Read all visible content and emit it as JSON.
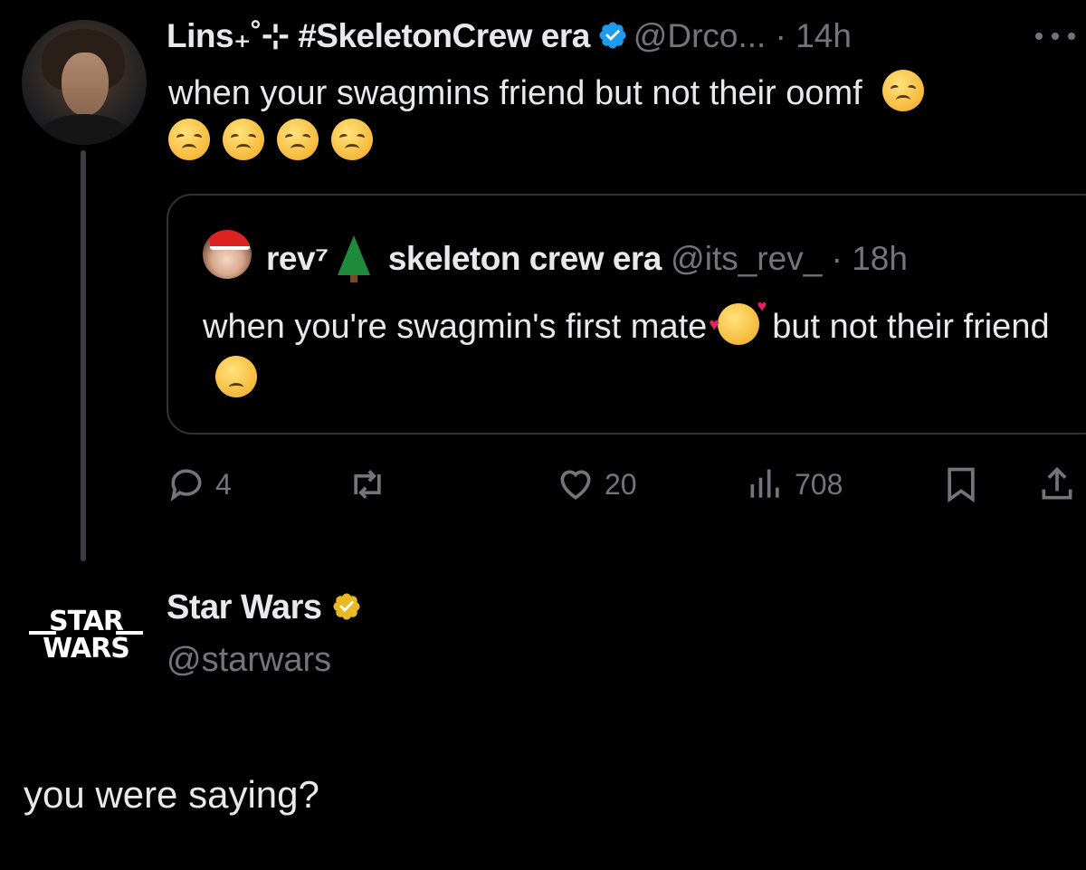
{
  "tweet": {
    "author": {
      "display_name": "Lins₊˚⊹ #SkeletonCrew era",
      "handle": "@Drco...",
      "time": "14h",
      "verified": true
    },
    "text": "when your swagmins friend but not their oomf",
    "emojis": [
      "disappointed-face",
      "disappointed-face",
      "disappointed-face",
      "disappointed-face",
      "disappointed-face"
    ],
    "quote": {
      "author": {
        "display_name": "rev⁷",
        "name_suffix": "skeleton crew era",
        "handle": "@its_rev_",
        "time": "18h"
      },
      "text_part1": "when you're swagmin's first mate",
      "text_part2": "but not their friend",
      "emojis": [
        "smiling-face-with-hearts",
        "pensive-face"
      ]
    },
    "actions": {
      "replies": "4",
      "retweets": "",
      "likes": "20",
      "views": "708"
    }
  },
  "reply": {
    "display_name": "Star Wars",
    "handle": "@starwars",
    "text": "you were saying?",
    "logo_text_line1": "STAR",
    "logo_text_line2": "WARS",
    "verified_color": "#e8b923"
  },
  "colors": {
    "background": "#000000",
    "text": "#e7e9ea",
    "muted": "#71767b",
    "verified_blue": "#1d9bf0",
    "verified_gold": "#e8b923",
    "border": "#2f3336"
  }
}
